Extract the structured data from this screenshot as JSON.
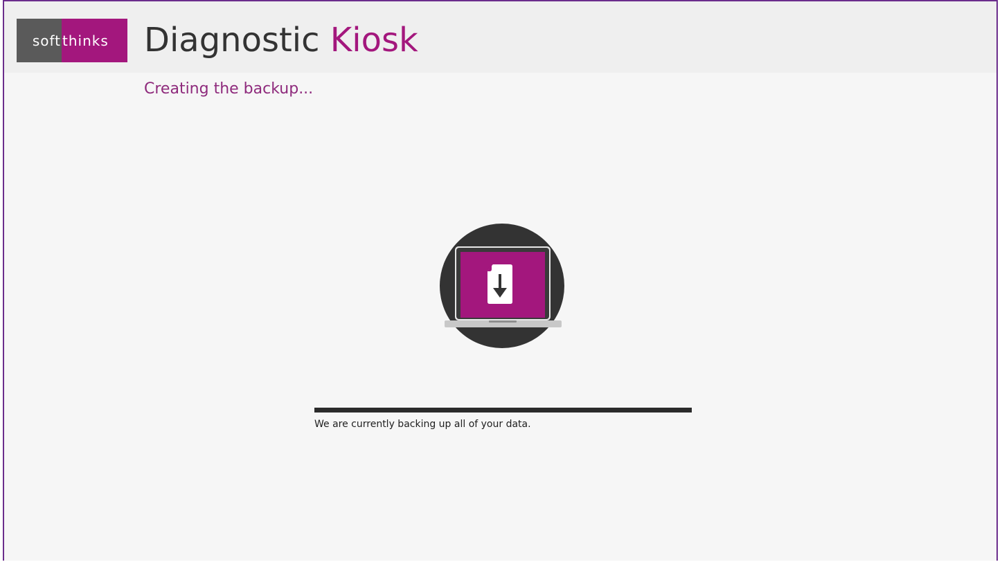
{
  "header": {
    "logo": {
      "left_text": "soft",
      "right_text": "thinks"
    },
    "title_main": "Diagnostic",
    "title_accent": "Kiosk"
  },
  "main": {
    "heading": "Creating the backup...",
    "illustration_icon": "laptop-download-file-icon",
    "progress": {
      "percent": 100
    },
    "status_message": "We are currently backing up all of your data."
  },
  "colors": {
    "accent": "#a3177d",
    "heading": "#8e2a7c",
    "logo_gray": "#5a5a5a",
    "frame": "#6b2d8c",
    "progress": "#2b2b2b"
  }
}
